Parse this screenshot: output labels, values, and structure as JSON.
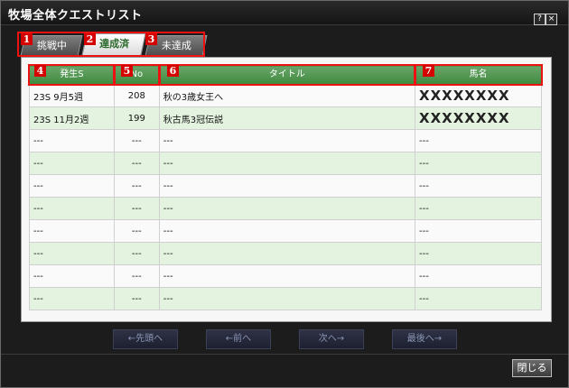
{
  "window": {
    "title": "牧場全体クエストリスト",
    "help": "?",
    "close": "×"
  },
  "tabs": [
    {
      "label": "挑戦中",
      "marker": "1"
    },
    {
      "label": "達成済",
      "marker": "2"
    },
    {
      "label": "未達成",
      "marker": "3"
    }
  ],
  "columns": [
    {
      "label": "発生S",
      "marker": "4"
    },
    {
      "label": "No",
      "marker": "5"
    },
    {
      "label": "タイトル",
      "marker": "6"
    },
    {
      "label": "馬名",
      "marker": "7"
    }
  ],
  "rows": [
    {
      "date": "23S 9月5週",
      "no": "208",
      "title": "秋の3歳女王へ",
      "horse": "XXXXXXXX"
    },
    {
      "date": "23S 11月2週",
      "no": "199",
      "title": "秋古馬3冠伝説",
      "horse": "XXXXXXXX"
    },
    {
      "date": "---",
      "no": "---",
      "title": "---",
      "horse": "---"
    },
    {
      "date": "---",
      "no": "---",
      "title": "---",
      "horse": "---"
    },
    {
      "date": "---",
      "no": "---",
      "title": "---",
      "horse": "---"
    },
    {
      "date": "---",
      "no": "---",
      "title": "---",
      "horse": "---"
    },
    {
      "date": "---",
      "no": "---",
      "title": "---",
      "horse": "---"
    },
    {
      "date": "---",
      "no": "---",
      "title": "---",
      "horse": "---"
    },
    {
      "date": "---",
      "no": "---",
      "title": "---",
      "horse": "---"
    },
    {
      "date": "---",
      "no": "---",
      "title": "---",
      "horse": "---"
    }
  ],
  "nav": {
    "first": "←先頭へ",
    "prev": "←前へ",
    "next": "次へ→",
    "last": "最後へ→"
  },
  "footer": {
    "close": "閉じる"
  }
}
